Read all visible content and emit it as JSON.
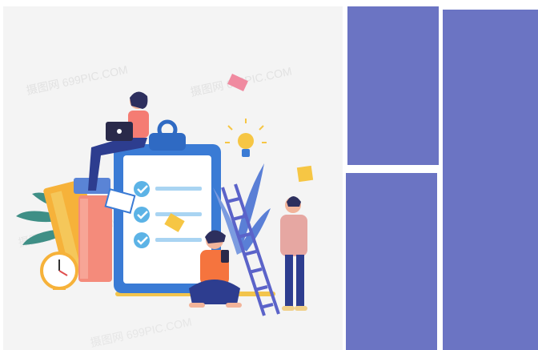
{
  "illustration": {
    "watermarks": [
      "摄图网 699PIC.COM",
      "摄图网 699PIC.COM",
      "摄图网 699PIC.COM",
      "摄图网 699PIC.COM"
    ]
  },
  "colors": {
    "panel": "#6b74c3",
    "background": "#f4f4f4"
  }
}
